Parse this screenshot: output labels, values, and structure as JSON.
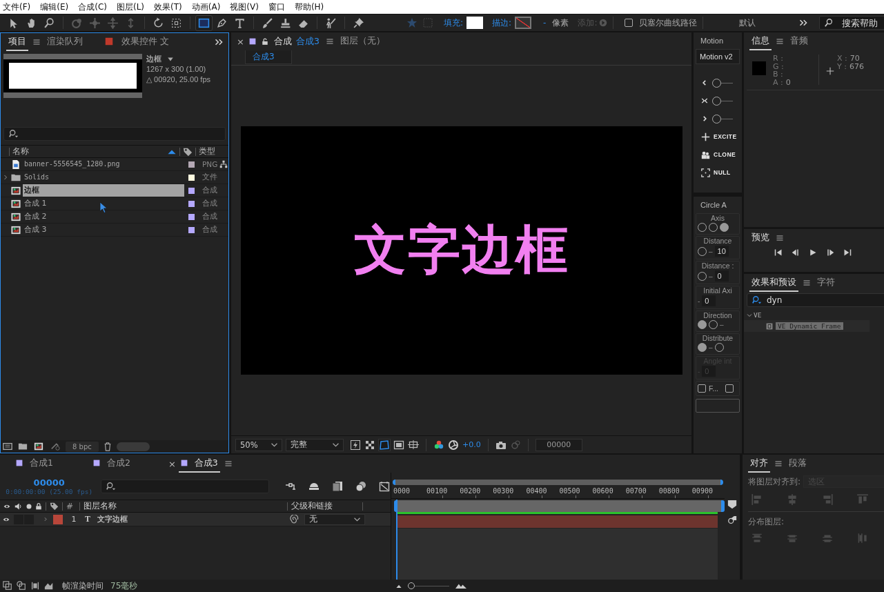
{
  "menu_bar": [
    "文件(F)",
    "编辑(E)",
    "合成(C)",
    "图层(L)",
    "效果(T)",
    "动画(A)",
    "视图(V)",
    "窗口",
    "帮助(H)"
  ],
  "toolbar": {
    "tools": [
      {
        "kind": "selection",
        "selected": false
      },
      {
        "kind": "hand",
        "selected": false
      },
      {
        "kind": "zoom",
        "selected": false
      },
      {
        "kind": "orbit",
        "selected": false
      },
      {
        "kind": "pan",
        "selected": false
      },
      {
        "kind": "move",
        "selected": false
      },
      {
        "kind": "dolly",
        "selected": false
      },
      {
        "kind": "rotate",
        "selected": false
      },
      {
        "kind": "region",
        "selected": false
      },
      {
        "kind": "rectangle",
        "selected": true
      },
      {
        "kind": "pen",
        "selected": false
      },
      {
        "kind": "text",
        "selected": false
      },
      {
        "kind": "brush",
        "selected": false
      },
      {
        "kind": "stamp",
        "selected": false
      },
      {
        "kind": "eraser",
        "selected": false
      },
      {
        "kind": "puppet",
        "selected": false
      },
      {
        "kind": "pin",
        "selected": false
      }
    ],
    "fill_label": "填充:",
    "stroke_label": "描边:",
    "stroke_width": "-",
    "stroke_unit": "像素",
    "add_label": "添加:",
    "bezier": {
      "label": "贝塞尔曲线路径",
      "checked": false
    },
    "workspace": "默认",
    "search": {
      "placeholder": "搜索帮助"
    }
  },
  "project": {
    "tabs": [
      {
        "label": "项目",
        "selected": true
      },
      {
        "label": "渲染队列",
        "selected": false
      },
      {
        "label": "效果控件 文",
        "selected": false
      }
    ],
    "preview": {
      "name": "边框",
      "size": "1267 x 300 (1.00)",
      "duration": "△ 00920, 25.00 fps"
    },
    "columns": {
      "name": "名称",
      "type": "类型"
    },
    "items": [
      {
        "kind": "image",
        "name": "banner-5556545_1280.png",
        "type": "PNG",
        "color": "#b4a8b4",
        "selected": false
      },
      {
        "kind": "folder",
        "name": "Solids",
        "type": "文件",
        "color": "#fffbe0",
        "selected": false,
        "expanded": false
      },
      {
        "kind": "comp",
        "name": "边框",
        "type": "合成",
        "color": "#b4a8ff",
        "selected": true
      },
      {
        "kind": "comp",
        "name": "合成 1",
        "type": "合成",
        "color": "#b4a8ff",
        "selected": false
      },
      {
        "kind": "comp",
        "name": "合成 2",
        "type": "合成",
        "color": "#b4a8ff",
        "selected": false
      },
      {
        "kind": "comp",
        "name": "合成 3",
        "type": "合成",
        "color": "#b4a8ff",
        "selected": false
      }
    ],
    "bit_depth": "8 bpc"
  },
  "viewer": {
    "tabs": [
      {
        "label": "合成",
        "target": "合成3",
        "selected": true,
        "close": "×"
      },
      {
        "label": "图层（无）",
        "selected": false
      }
    ],
    "breadcrumb": "合成3",
    "canvas_text": "文字边框",
    "zoom": "50%",
    "resolution": "完整",
    "exposure": "+0.0",
    "timecode": "00000"
  },
  "motion": {
    "title": "Motion",
    "version": "Motion v2",
    "sliders": [
      {
        "kind": "left",
        "level": 0
      },
      {
        "kind": "both",
        "level": 0
      },
      {
        "kind": "right",
        "level": 0
      }
    ],
    "buttons": [
      {
        "kind": "excite",
        "label": "EXCITE"
      },
      {
        "kind": "clone",
        "label": "CLONE"
      },
      {
        "kind": "null",
        "label": "NULL"
      }
    ]
  },
  "circle": {
    "title": "Circle A",
    "groups": [
      {
        "label": "Axis",
        "disabled": false,
        "controls": [
          {
            "kind": "radio",
            "selected": false
          },
          {
            "kind": "radio",
            "selected": false
          },
          {
            "kind": "radio",
            "selected": true
          }
        ]
      },
      {
        "label": "Distance",
        "disabled": false,
        "controls": [
          {
            "kind": "knob"
          },
          {
            "kind": "dash",
            "text": "–"
          },
          {
            "kind": "field",
            "value": "10"
          }
        ]
      },
      {
        "label": "Distance :",
        "disabled": false,
        "controls": [
          {
            "kind": "knob"
          },
          {
            "kind": "dash",
            "text": "–"
          },
          {
            "kind": "field",
            "value": "0"
          }
        ]
      },
      {
        "label": "Initial Axi",
        "disabled": false,
        "controls": [
          {
            "kind": "dash",
            "text": "-"
          },
          {
            "kind": "field",
            "value": "0"
          }
        ]
      },
      {
        "label": "Direction",
        "disabled": false,
        "controls": [
          {
            "kind": "radio",
            "selected": true
          },
          {
            "kind": "radio",
            "selected": false
          },
          {
            "kind": "dash",
            "text": "–"
          }
        ]
      },
      {
        "label": "Distribute",
        "disabled": false,
        "controls": [
          {
            "kind": "radio",
            "selected": true
          },
          {
            "kind": "dash",
            "text": "–"
          },
          {
            "kind": "radio",
            "selected": false
          }
        ]
      },
      {
        "label": "Angle int",
        "disabled": true,
        "controls": [
          {
            "kind": "dash",
            "text": "-"
          },
          {
            "kind": "field",
            "value": "0"
          }
        ]
      }
    ],
    "checkboxes": [
      {
        "label": "F...",
        "checked": false
      },
      {
        "checked": false
      }
    ]
  },
  "info": {
    "tabs": [
      {
        "label": "信息",
        "selected": true
      },
      {
        "label": "音频",
        "selected": false
      }
    ],
    "channels": [
      {
        "label": "R :"
      },
      {
        "label": "G :"
      },
      {
        "label": "B :"
      },
      {
        "label": "A :",
        "value": "0"
      }
    ],
    "coords": [
      {
        "label": "X :",
        "value": "70"
      },
      {
        "label": "Y :",
        "value": "676"
      }
    ]
  },
  "preview": {
    "title": "预览"
  },
  "effects": {
    "tabs": [
      {
        "label": "效果和预设",
        "selected": true
      },
      {
        "label": "字符",
        "selected": false
      }
    ],
    "search": "dyn",
    "tree": [
      {
        "label": "VE",
        "expanded": true,
        "selected": false,
        "children": [
          {
            "label": "VE Dynamic Frame",
            "selected": true
          }
        ]
      }
    ]
  },
  "timeline": {
    "tabs": [
      {
        "label": "合成1",
        "selected": false
      },
      {
        "label": "合成2",
        "selected": false
      },
      {
        "label": "合成3",
        "selected": true,
        "close": "×"
      }
    ],
    "timecode": "00000",
    "timecode_detail": "0:00:00:00 (25.00 fps)",
    "columns": {
      "number": "#",
      "layer_name": "图层名称",
      "parent": "父级和链接"
    },
    "ruler": [
      "0000",
      "00100",
      "00200",
      "00300",
      "00400",
      "00500",
      "00600",
      "00700",
      "00800",
      "00900"
    ],
    "layers": [
      {
        "number": "1",
        "type_glyph": "T",
        "name": "文字边框",
        "parent": "无",
        "color": "#b8463a",
        "visible": true
      }
    ]
  },
  "align": {
    "tabs": [
      {
        "label": "对齐",
        "selected": true
      },
      {
        "label": "段落",
        "selected": false
      }
    ],
    "align_to_label": "将图层对齐到:",
    "align_to": "选区",
    "distribute_label": "分布图层:"
  },
  "status": {
    "render_label": "帧渲染时间",
    "render_time": "75毫秒",
    "zoom": {
      "level": 0
    }
  }
}
